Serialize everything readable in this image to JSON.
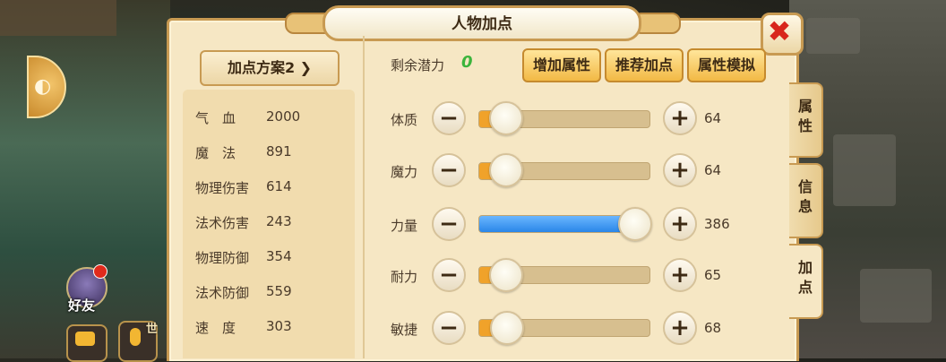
{
  "window": {
    "title": "人物加点",
    "close_symbol": "✖"
  },
  "scheme": {
    "label": "加点方案2 ❯"
  },
  "stats": [
    {
      "name": "气　血",
      "value": "2000"
    },
    {
      "name": "魔　法",
      "value": "891"
    },
    {
      "name": "物理伤害",
      "value": "614"
    },
    {
      "name": "法术伤害",
      "value": "243"
    },
    {
      "name": "物理防御",
      "value": "354"
    },
    {
      "name": "法术防御",
      "value": "559"
    },
    {
      "name": "速　度",
      "value": "303"
    }
  ],
  "potential": {
    "label": "剩余潜力",
    "value": "0"
  },
  "actions": [
    {
      "label": "增加属性"
    },
    {
      "label": "推荐加点"
    },
    {
      "label": "属性模拟"
    }
  ],
  "attributes": [
    {
      "name": "体质",
      "value": "64",
      "level": 0.15
    },
    {
      "name": "魔力",
      "value": "64",
      "level": 0.15
    },
    {
      "name": "力量",
      "value": "386",
      "level": 0.93
    },
    {
      "name": "耐力",
      "value": "65",
      "level": 0.15
    },
    {
      "name": "敏捷",
      "value": "68",
      "level": 0.16
    }
  ],
  "side_tabs": [
    {
      "label": "属性",
      "active": false
    },
    {
      "label": "信息",
      "active": false
    },
    {
      "label": "加点",
      "active": true
    }
  ],
  "hud": {
    "friend_label": "好友",
    "world_label": "世"
  },
  "colors": {
    "fill_orange": "#f0a22a",
    "fill_blue": "#2a86e8",
    "close_red": "#d8261c",
    "potential_green": "#3cb43c"
  }
}
